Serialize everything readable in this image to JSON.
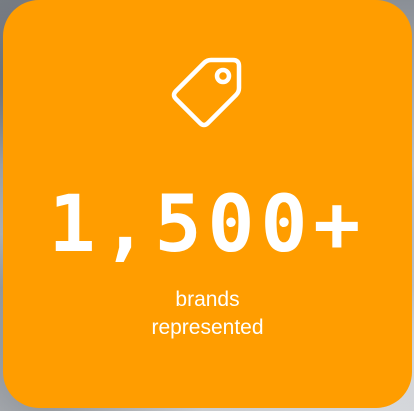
{
  "stat_card": {
    "icon": "price-tag-icon",
    "number": "1,500+",
    "label_line1": "brands",
    "label_line2": "represented",
    "background_color": "#ff9d00",
    "text_color": "#ffffff"
  }
}
